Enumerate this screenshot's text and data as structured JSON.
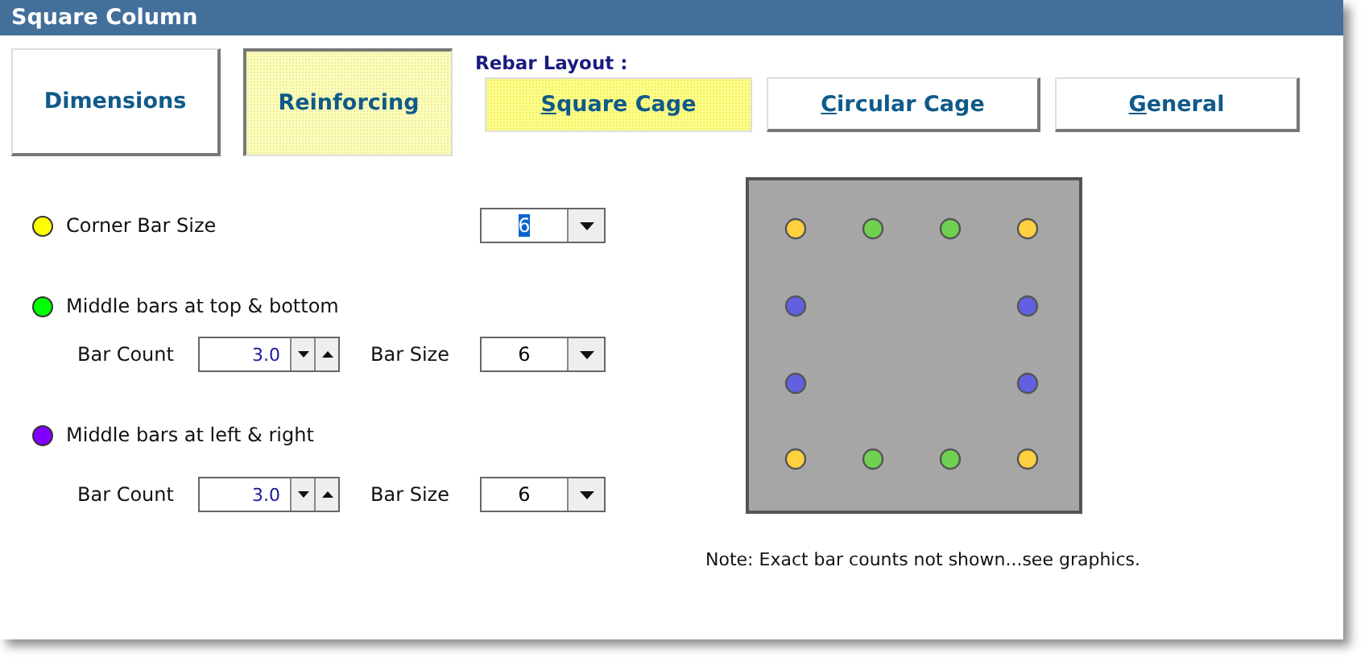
{
  "window": {
    "title": "Square Column"
  },
  "tabs": [
    {
      "label": "Dimensions",
      "selected": false
    },
    {
      "label": "Reinforcing",
      "selected": true
    }
  ],
  "rebar_layout": {
    "label": "Rebar Layout :",
    "options": [
      {
        "label": "Square Cage",
        "selected": true,
        "mnemonic": true
      },
      {
        "label": "Circular Cage",
        "selected": false,
        "mnemonic": true
      },
      {
        "label": "General",
        "selected": false,
        "mnemonic": true
      }
    ]
  },
  "groups": [
    {
      "kind": "single",
      "color": "#ffff00",
      "label": "Corner Bar Size",
      "bar_size": {
        "value": "6",
        "text_selected": true
      }
    },
    {
      "kind": "count",
      "color": "#00ff00",
      "label": "Middle bars at top & bottom",
      "bar_count": {
        "label": "Bar Count",
        "value": "3.0"
      },
      "bar_size": {
        "label": "Bar Size",
        "value": "6",
        "text_selected": false
      }
    },
    {
      "kind": "count",
      "color": "#8000ff",
      "label": "Middle bars at left & right",
      "bar_count": {
        "label": "Bar Count",
        "value": "3.0"
      },
      "bar_size": {
        "label": "Bar Size",
        "value": "6",
        "text_selected": false
      }
    }
  ],
  "note": "Note: Exact bar counts not shown...see graphics."
}
